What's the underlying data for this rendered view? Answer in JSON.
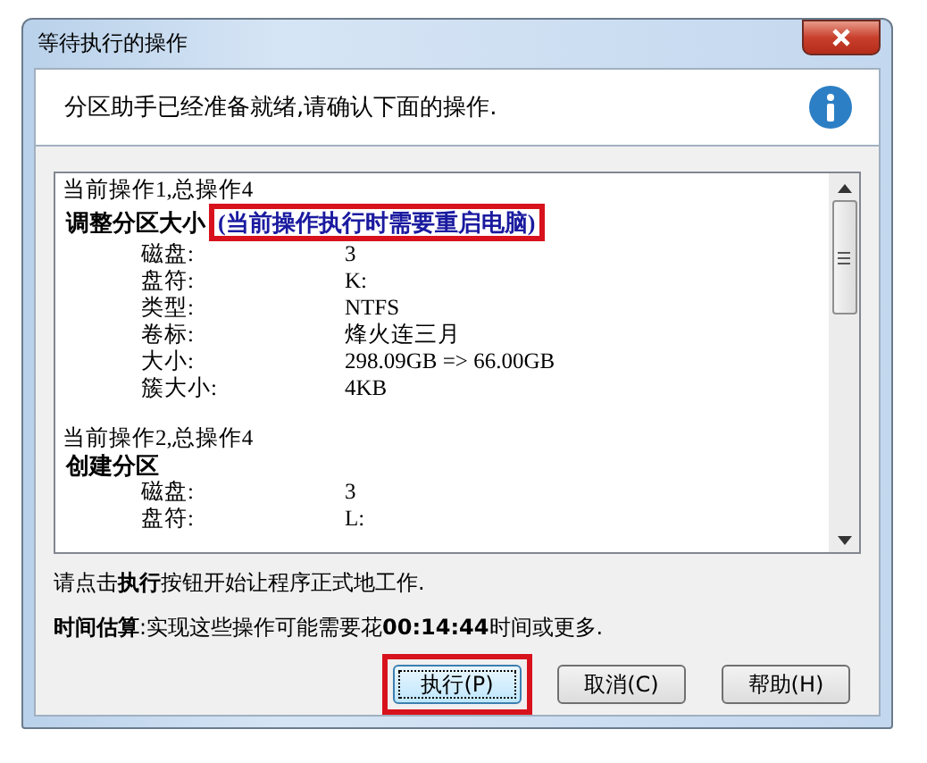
{
  "window": {
    "title": "等待执行的操作"
  },
  "header": {
    "message": "分区助手已经准备就绪,请确认下面的操作."
  },
  "operations": [
    {
      "counter": "当前操作1,总操作4",
      "name": "调整分区大小",
      "note": "(当前操作执行时需要重启电脑)",
      "note_highlighted": true,
      "fields": [
        {
          "label": "磁盘:",
          "value": "3"
        },
        {
          "label": "盘符:",
          "value": "K:"
        },
        {
          "label": "类型:",
          "value": "NTFS"
        },
        {
          "label": "卷标:",
          "value": "烽火连三月"
        },
        {
          "label": "大小:",
          "value": "298.09GB => 66.00GB"
        },
        {
          "label": "簇大小:",
          "value": "4KB"
        }
      ]
    },
    {
      "counter": "当前操作2,总操作4",
      "name": "创建分区",
      "fields": [
        {
          "label": "磁盘:",
          "value": "3"
        },
        {
          "label": "盘符:",
          "value": "L:"
        }
      ]
    }
  ],
  "instruction": "请点击**执行**按钮开始让程序正式地工作.",
  "estimate": "**时间估算**:实现这些操作可能需要花**00:14:44**时间或更多.",
  "buttons": [
    {
      "label": "执行(P)",
      "focused": true,
      "highlighted": true
    },
    {
      "label": "取消(C)",
      "focused": false,
      "highlighted": false
    },
    {
      "label": "帮助(H)",
      "focused": false,
      "highlighted": false
    }
  ]
}
